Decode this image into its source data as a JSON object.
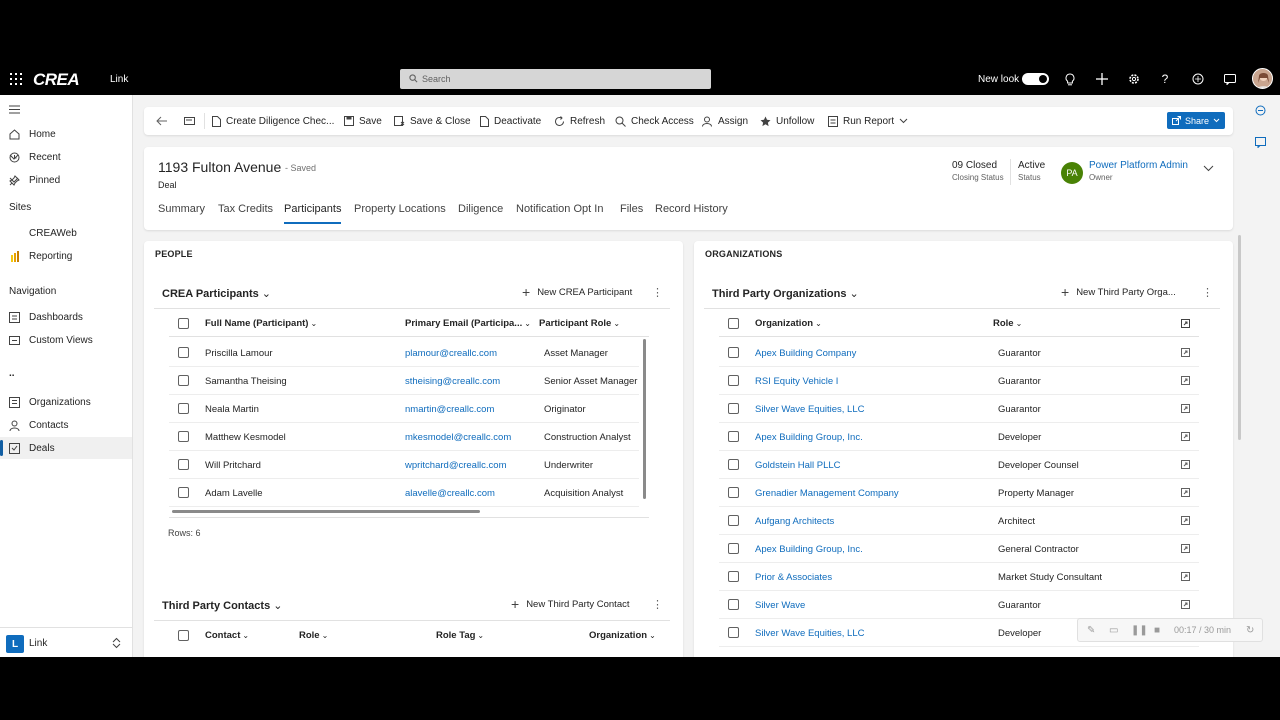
{
  "topbar": {
    "brand": "CREA",
    "app_name": "Link",
    "search_placeholder": "Search",
    "new_look_label": "New look"
  },
  "nav": {
    "home": "Home",
    "recent": "Recent",
    "pinned": "Pinned",
    "sites_header": "Sites",
    "creaweb": "CREAWeb",
    "reporting": "Reporting",
    "navigation_header": "Navigation",
    "dashboards": "Dashboards",
    "custom_views": "Custom Views",
    "ellipsis": "..",
    "organizations": "Organizations",
    "contacts": "Contacts",
    "deals": "Deals",
    "footer_initial": "L",
    "footer_label": "Link"
  },
  "commands": {
    "create_diligence": "Create Diligence Chec...",
    "save": "Save",
    "save_close": "Save & Close",
    "deactivate": "Deactivate",
    "refresh": "Refresh",
    "check_access": "Check Access",
    "assign": "Assign",
    "unfollow": "Unfollow",
    "run_report": "Run Report",
    "share": "Share"
  },
  "record": {
    "title": "1193 Fulton Avenue",
    "saved": "- Saved",
    "entity": "Deal",
    "closing_status_value": "09 Closed",
    "closing_status_label": "Closing Status",
    "status_value": "Active",
    "status_label": "Status",
    "owner_initials": "PA",
    "owner_name": "Power Platform Admin",
    "owner_label": "Owner"
  },
  "tabs": [
    "Summary",
    "Tax Credits",
    "Participants",
    "Property Locations",
    "Diligence",
    "Notification Opt In",
    "Files",
    "Record History"
  ],
  "people": {
    "section_title": "PEOPLE",
    "grid_title": "CREA Participants",
    "new_button": "New CREA Participant",
    "columns": [
      "Full Name (Participant)",
      "Primary Email (Participa...",
      "Participant Role"
    ],
    "rows": [
      [
        "Priscilla Lamour",
        "plamour@creallc.com",
        "Asset Manager"
      ],
      [
        "Samantha Theising",
        "stheising@creallc.com",
        "Senior Asset Manager"
      ],
      [
        "Neala Martin",
        "nmartin@creallc.com",
        "Originator"
      ],
      [
        "Matthew Kesmodel",
        "mkesmodel@creallc.com",
        "Construction Analyst"
      ],
      [
        "Will Pritchard",
        "wpritchard@creallc.com",
        "Underwriter"
      ],
      [
        "Adam Lavelle",
        "alavelle@creallc.com",
        "Acquisition Analyst"
      ]
    ],
    "row_count": "Rows: 6",
    "contacts_title": "Third Party Contacts",
    "contacts_new_button": "New Third Party Contact",
    "contacts_columns": [
      "Contact",
      "Role",
      "Role Tag",
      "Organization"
    ]
  },
  "orgs": {
    "section_title": "ORGANIZATIONS",
    "grid_title": "Third Party Organizations",
    "new_button": "New Third Party Orga...",
    "columns": [
      "Organization",
      "Role"
    ],
    "rows": [
      [
        "Apex Building Company",
        "Guarantor"
      ],
      [
        "RSI Equity Vehicle I",
        "Guarantor"
      ],
      [
        "Silver Wave Equities, LLC",
        "Guarantor"
      ],
      [
        "Apex Building Group, Inc.",
        "Developer"
      ],
      [
        "Goldstein Hall PLLC",
        "Developer Counsel"
      ],
      [
        "Grenadier Management Company",
        "Property Manager"
      ],
      [
        "Aufgang Architects",
        "Architect"
      ],
      [
        "Apex Building Group, Inc.",
        "General Contractor"
      ],
      [
        "Prior & Associates",
        "Market Study Consultant"
      ],
      [
        "Silver Wave",
        "Guarantor"
      ],
      [
        "Silver Wave Equities, LLC",
        "Developer"
      ]
    ]
  },
  "recorder": {
    "time": "00:17 / 30 min"
  }
}
